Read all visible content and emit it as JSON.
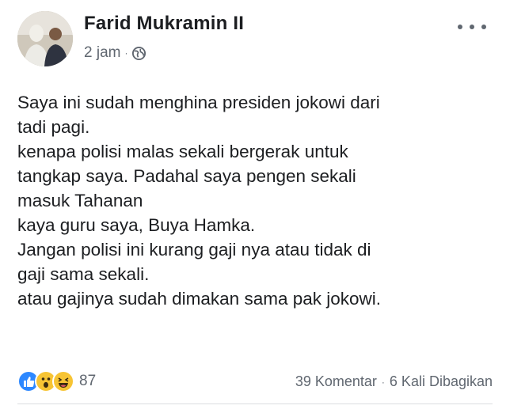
{
  "author": {
    "name": "Farid Mukramin II",
    "timestamp": "2 jam",
    "separator": "·",
    "privacy_icon": "globe-icon"
  },
  "menu": {
    "icon": "more-options-icon"
  },
  "post": {
    "lines": [
      "Saya ini sudah menghina presiden jokowi dari",
      "tadi pagi.",
      "kenapa polisi malas sekali bergerak untuk",
      "tangkap  saya. Padahal saya pengen sekali",
      "masuk Tahanan",
      "kaya guru saya, Buya Hamka.",
      "Jangan polisi ini kurang gaji nya atau tidak di",
      "gaji sama sekali.",
      "atau gajinya sudah dimakan sama pak jokowi."
    ]
  },
  "engagement": {
    "reaction_icons": [
      "like-icon",
      "wow-icon",
      "haha-icon"
    ],
    "reaction_count": "87",
    "comments": "39 Komentar",
    "separator": "·",
    "shares": "6 Kali Dibagikan"
  },
  "colors": {
    "text": "#1c1e21",
    "secondary": "#606770",
    "like_blue": "#2d88ff",
    "emoji_yellow": "#f7c434"
  }
}
